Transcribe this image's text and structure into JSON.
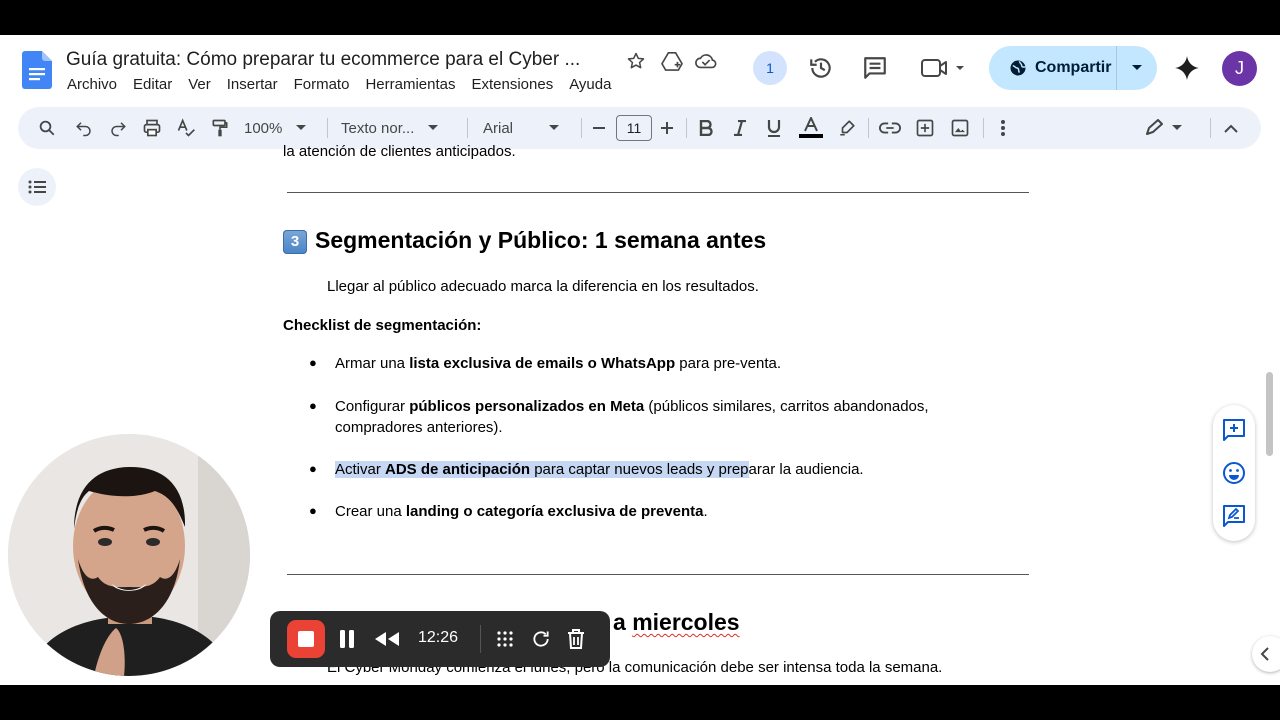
{
  "document": {
    "title": "Guía gratuita: Cómo preparar tu ecommerce para el Cyber ...",
    "menu": [
      "Archivo",
      "Editar",
      "Ver",
      "Insertar",
      "Formato",
      "Herramientas",
      "Extensiones",
      "Ayuda"
    ]
  },
  "header": {
    "viewer_count": "1",
    "share_label": "Compartir",
    "avatar_initial": "J"
  },
  "toolbar": {
    "zoom": "100%",
    "style": "Texto nor...",
    "font": "Arial",
    "font_size": "11"
  },
  "content": {
    "top_partial": "la atención de clientes anticipados.",
    "section3_keycap": "3",
    "section3_title": "Segmentación y Público: 1 semana antes",
    "intro": "Llegar al público adecuado marca la diferencia en los resultados.",
    "checklist_label": "Checklist de segmentación:",
    "bullets": [
      {
        "pre": "Armar una ",
        "bold": "lista exclusiva de emails o WhatsApp",
        "post": " para pre-venta."
      },
      {
        "pre": "Configurar ",
        "bold": "públicos personalizados en Meta",
        "post": " (públicos similares, carritos abandonados,",
        "line2": "compradores anteriores)."
      },
      {
        "pre": "Activar ",
        "bold": "ADS de anticipación",
        "post_hl": " para captar nuevos leads y prep",
        "post": "arar la audiencia."
      },
      {
        "pre": "Crear una ",
        "bold": "landing o categoría exclusiva de preventa",
        "post": "."
      }
    ],
    "section4_title_a": "a ",
    "section4_title_b": "miercoles",
    "section4_intro": "El Cyber Monday comienza el lunes, pero la comunicación debe ser intensa toda la semana."
  },
  "recorder": {
    "time": "12:26"
  },
  "colors": {
    "accent": "#0b57d0",
    "share_bg": "#c2e7ff",
    "toolbar_bg": "#edf2fa",
    "record_red": "#ea4335",
    "selection": "#c5d7f3"
  }
}
